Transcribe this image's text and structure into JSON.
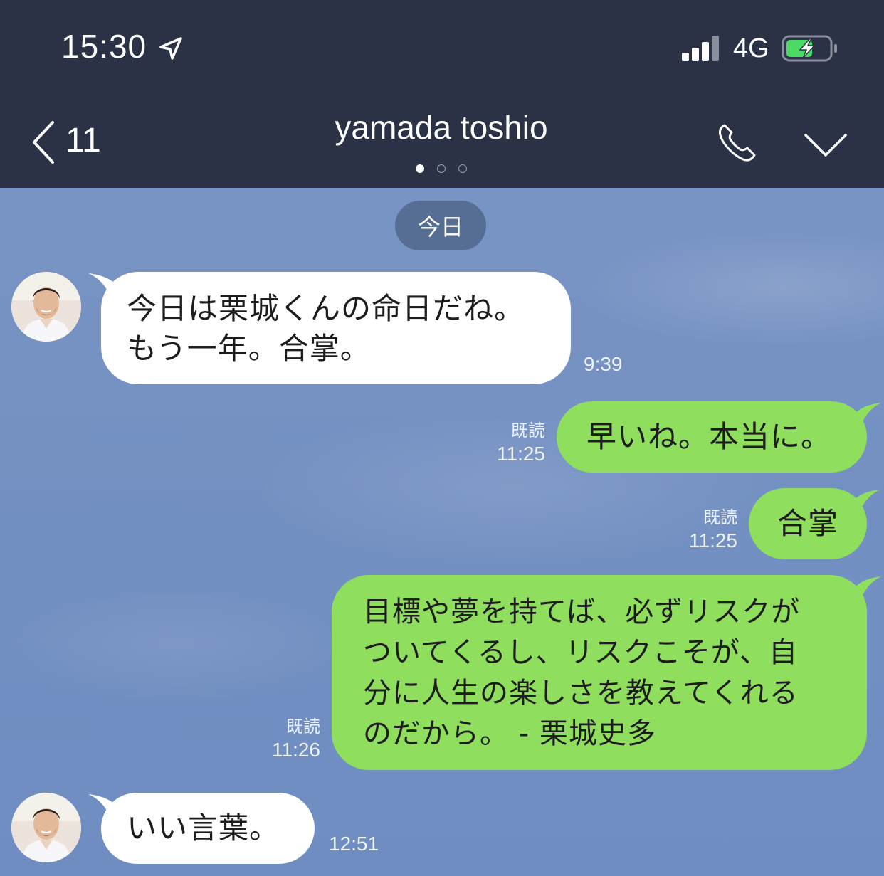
{
  "status_bar": {
    "time": "15:30",
    "network": "4G"
  },
  "header": {
    "back_count": "11",
    "title": "yamada toshio"
  },
  "chat": {
    "date_label": "今日",
    "messages": [
      {
        "side": "left",
        "text": "今日は栗城くんの命日だね。\nもう一年。合掌。",
        "time": "9:39"
      },
      {
        "side": "right",
        "text": "早いね。本当に。",
        "read": "既読",
        "time": "11:25"
      },
      {
        "side": "right",
        "text": "合掌",
        "read": "既読",
        "time": "11:25"
      },
      {
        "side": "right",
        "text": "目標や夢を持てば、必ずリスクが\nついてくるし、リスクこそが、自\n分に人生の楽しさを教えてくれる\nのだから。 - 栗城史多",
        "read": "既読",
        "time": "11:26"
      },
      {
        "side": "left",
        "text": "いい言葉。",
        "time": "12:51"
      }
    ]
  },
  "colors": {
    "header_bg": "#2b3246",
    "chat_bg": "#7390c2",
    "bubble_green": "#8fde5d",
    "bubble_white": "#ffffff",
    "battery_green": "#4cd964"
  },
  "icons": [
    "location-arrow-icon",
    "signal-icon",
    "battery-charging-icon",
    "back-chevron-icon",
    "phone-icon",
    "chevron-down-icon"
  ]
}
